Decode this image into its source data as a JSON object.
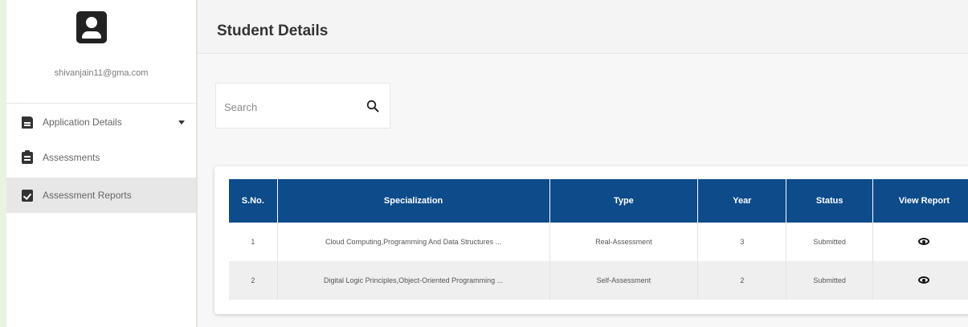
{
  "sidebar": {
    "email": "shivanjain11@gma.com",
    "items": [
      {
        "label": "Application Details",
        "icon": "file-icon",
        "has_caret": true
      },
      {
        "label": "Assessments",
        "icon": "clipboard-icon"
      },
      {
        "label": "Assessment Reports",
        "icon": "clipboard-check-icon",
        "active": true
      }
    ]
  },
  "header": {
    "title": "Student Details"
  },
  "search": {
    "placeholder": "Search"
  },
  "table": {
    "headers": [
      "S.No.",
      "Specialization",
      "Type",
      "Year",
      "Status",
      "View Report"
    ],
    "rows": [
      {
        "sno": "1",
        "specialization": "Cloud Computing,Programming And Data Structures ...",
        "type": "Real-Assessment",
        "year": "3",
        "status": "Submitted"
      },
      {
        "sno": "2",
        "specialization": "Digital Logic Principles,Object-Oriented Programming ...",
        "type": "Self-Assessment",
        "year": "2",
        "status": "Submitted"
      }
    ]
  },
  "colors": {
    "table_header": "#0d4b8a",
    "active_nav": "#e7e7e7"
  }
}
